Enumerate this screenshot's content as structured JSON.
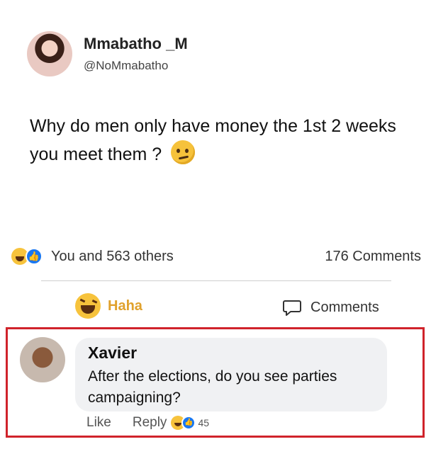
{
  "post": {
    "author_name": "Mmabatho _M",
    "author_handle": "@NoMmabatho",
    "text": "Why do men only have money the 1st 2 weeks you meet them ?",
    "text_emoji": "smirk-emoji-icon"
  },
  "reactions": {
    "summary": "You and 563 others",
    "comments_count": "176  Comments"
  },
  "actions": {
    "haha_label": "Haha",
    "comments_label": "Comments"
  },
  "comment": {
    "name": "Xavier",
    "text": "After the elections, do you see parties campaigning?",
    "like_label": "Like",
    "reply_label": "Reply",
    "reaction_count": "45"
  },
  "colors": {
    "highlight_border": "#d0232b",
    "haha_text": "#e0a12c",
    "like_blue": "#1877f2",
    "bubble_bg": "#f0f1f3"
  }
}
